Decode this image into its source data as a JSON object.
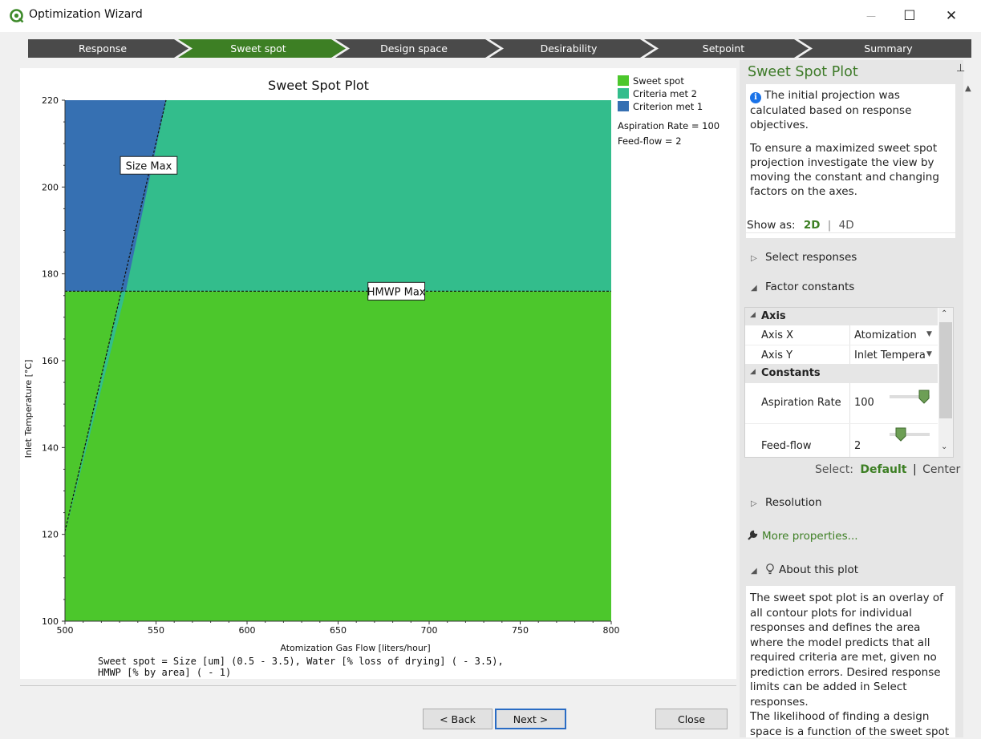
{
  "window": {
    "title": "Optimization Wizard",
    "min_glyph": "—",
    "max_glyph": "☐",
    "close_glyph": "✕"
  },
  "steps": [
    {
      "label": "Response",
      "state": "done"
    },
    {
      "label": "Sweet spot",
      "state": "active"
    },
    {
      "label": "Design space",
      "state": "pending"
    },
    {
      "label": "Desirability",
      "state": "pending"
    },
    {
      "label": "Setpoint",
      "state": "pending"
    },
    {
      "label": "Summary",
      "state": "pending"
    }
  ],
  "chart_data": {
    "type": "area",
    "title": "Sweet Spot Plot",
    "xlabel": "Atomization Gas Flow [liters/hour]",
    "ylabel": "Inlet Temperature [°C]",
    "xlim": [
      500,
      800
    ],
    "ylim": [
      100,
      220
    ],
    "xticks": [
      500,
      550,
      600,
      650,
      700,
      750,
      800
    ],
    "yticks": [
      100,
      120,
      140,
      160,
      180,
      200,
      220
    ],
    "legend": [
      {
        "name": "Sweet spot",
        "color": "#4cc72c"
      },
      {
        "name": "Criteria met 2",
        "color": "#33bd8c"
      },
      {
        "name": "Criterion met 1",
        "color": "#3670b2"
      }
    ],
    "legend_notes": [
      "Aspiration Rate = 100",
      "Feed-flow = 2"
    ],
    "regions": [
      {
        "name": "Criterion met 1",
        "color": "#3670b2",
        "points": [
          [
            500,
            220
          ],
          [
            555.5,
            220
          ],
          [
            533.4,
            176
          ],
          [
            500,
            176
          ]
        ]
      },
      {
        "name": "Criteria met 2",
        "color": "#33bd8c",
        "points": [
          [
            555.5,
            220
          ],
          [
            800,
            220
          ],
          [
            800,
            176
          ],
          [
            533.4,
            176
          ],
          [
            500,
            120
          ]
        ]
      },
      {
        "name": "Sweet spot",
        "color": "#4cc72c",
        "points": [
          [
            500,
            176
          ],
          [
            800,
            176
          ],
          [
            800,
            100
          ],
          [
            500,
            100
          ]
        ]
      }
    ],
    "boundaries": [
      {
        "label": "Size Max",
        "points": [
          [
            500,
            120.7
          ],
          [
            555.5,
            220
          ]
        ],
        "label_at": [
          546,
          205
        ]
      },
      {
        "label": "HMWP Max",
        "points": [
          [
            500,
            176
          ],
          [
            800,
            176
          ]
        ],
        "label_at": [
          682,
          176
        ]
      }
    ],
    "footnote_lines": [
      "Sweet spot = Size [um] (0.5 - 3.5), Water [% loss of drying] ( - 3.5),",
      "HMWP [% by area] ( - 1)"
    ],
    "grid": false,
    "legend_position": "right"
  },
  "buttons": {
    "back": "< Back",
    "next": "Next >",
    "close": "Close"
  },
  "side": {
    "title": "Sweet Spot Plot",
    "pin_glyph": "⊥",
    "info_line1": "The initial projection was calculated based on response objectives.",
    "info_line2": "To ensure a maximized sweet spot projection investigate the view by moving the constant and changing factors on the axes.",
    "show_as_label": "Show as:",
    "show_as_2d": "2D",
    "show_as_4d": "4D",
    "select_responses": "Select responses",
    "factor_constants": "Factor constants",
    "grid": {
      "axis_header": "Axis",
      "axis_x_label": "Axis X",
      "axis_x_value": "Atomization",
      "axis_y_label": "Axis Y",
      "axis_y_value": "Inlet Tempera",
      "constants_header": "Constants",
      "aspiration_label": "Aspiration Rate",
      "aspiration_value": "100",
      "aspiration_slider": 1.0,
      "feedflow_label": "Feed-flow",
      "feedflow_value": "2",
      "feedflow_slider": 0.2
    },
    "select_label": "Select:",
    "select_default": "Default",
    "select_center": "Center",
    "resolution": "Resolution",
    "more_properties": "More properties...",
    "about_title": "About this plot",
    "about_text1": "The sweet spot plot is an overlay of all contour plots for individual responses and defines the area where the model predicts that all required criteria are met, given no prediction errors. Desired response limits can be added in Select responses.",
    "about_text2": "The likelihood of finding a design space is a function of the sweet spot"
  }
}
